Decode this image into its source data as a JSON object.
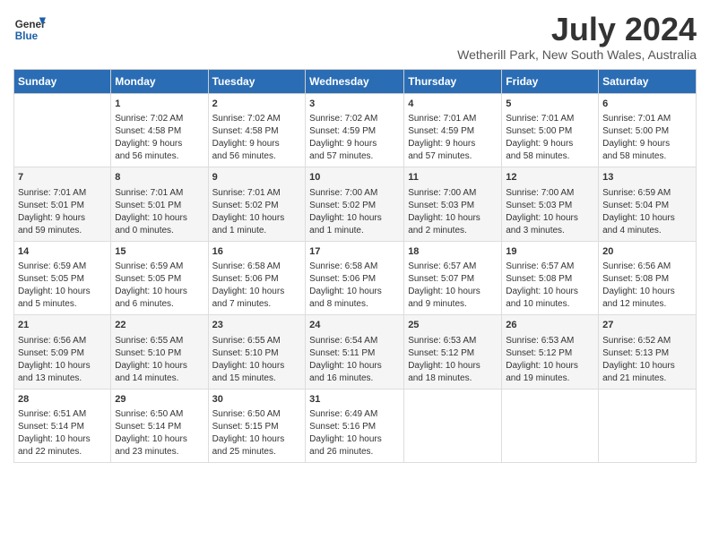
{
  "logo": {
    "line1": "General",
    "line2": "Blue"
  },
  "title": "July 2024",
  "location": "Wetherill Park, New South Wales, Australia",
  "headers": [
    "Sunday",
    "Monday",
    "Tuesday",
    "Wednesday",
    "Thursday",
    "Friday",
    "Saturday"
  ],
  "weeks": [
    [
      {
        "day": "",
        "content": ""
      },
      {
        "day": "1",
        "content": "Sunrise: 7:02 AM\nSunset: 4:58 PM\nDaylight: 9 hours\nand 56 minutes."
      },
      {
        "day": "2",
        "content": "Sunrise: 7:02 AM\nSunset: 4:58 PM\nDaylight: 9 hours\nand 56 minutes."
      },
      {
        "day": "3",
        "content": "Sunrise: 7:02 AM\nSunset: 4:59 PM\nDaylight: 9 hours\nand 57 minutes."
      },
      {
        "day": "4",
        "content": "Sunrise: 7:01 AM\nSunset: 4:59 PM\nDaylight: 9 hours\nand 57 minutes."
      },
      {
        "day": "5",
        "content": "Sunrise: 7:01 AM\nSunset: 5:00 PM\nDaylight: 9 hours\nand 58 minutes."
      },
      {
        "day": "6",
        "content": "Sunrise: 7:01 AM\nSunset: 5:00 PM\nDaylight: 9 hours\nand 58 minutes."
      }
    ],
    [
      {
        "day": "7",
        "content": "Sunrise: 7:01 AM\nSunset: 5:01 PM\nDaylight: 9 hours\nand 59 minutes."
      },
      {
        "day": "8",
        "content": "Sunrise: 7:01 AM\nSunset: 5:01 PM\nDaylight: 10 hours\nand 0 minutes."
      },
      {
        "day": "9",
        "content": "Sunrise: 7:01 AM\nSunset: 5:02 PM\nDaylight: 10 hours\nand 1 minute."
      },
      {
        "day": "10",
        "content": "Sunrise: 7:00 AM\nSunset: 5:02 PM\nDaylight: 10 hours\nand 1 minute."
      },
      {
        "day": "11",
        "content": "Sunrise: 7:00 AM\nSunset: 5:03 PM\nDaylight: 10 hours\nand 2 minutes."
      },
      {
        "day": "12",
        "content": "Sunrise: 7:00 AM\nSunset: 5:03 PM\nDaylight: 10 hours\nand 3 minutes."
      },
      {
        "day": "13",
        "content": "Sunrise: 6:59 AM\nSunset: 5:04 PM\nDaylight: 10 hours\nand 4 minutes."
      }
    ],
    [
      {
        "day": "14",
        "content": "Sunrise: 6:59 AM\nSunset: 5:05 PM\nDaylight: 10 hours\nand 5 minutes."
      },
      {
        "day": "15",
        "content": "Sunrise: 6:59 AM\nSunset: 5:05 PM\nDaylight: 10 hours\nand 6 minutes."
      },
      {
        "day": "16",
        "content": "Sunrise: 6:58 AM\nSunset: 5:06 PM\nDaylight: 10 hours\nand 7 minutes."
      },
      {
        "day": "17",
        "content": "Sunrise: 6:58 AM\nSunset: 5:06 PM\nDaylight: 10 hours\nand 8 minutes."
      },
      {
        "day": "18",
        "content": "Sunrise: 6:57 AM\nSunset: 5:07 PM\nDaylight: 10 hours\nand 9 minutes."
      },
      {
        "day": "19",
        "content": "Sunrise: 6:57 AM\nSunset: 5:08 PM\nDaylight: 10 hours\nand 10 minutes."
      },
      {
        "day": "20",
        "content": "Sunrise: 6:56 AM\nSunset: 5:08 PM\nDaylight: 10 hours\nand 12 minutes."
      }
    ],
    [
      {
        "day": "21",
        "content": "Sunrise: 6:56 AM\nSunset: 5:09 PM\nDaylight: 10 hours\nand 13 minutes."
      },
      {
        "day": "22",
        "content": "Sunrise: 6:55 AM\nSunset: 5:10 PM\nDaylight: 10 hours\nand 14 minutes."
      },
      {
        "day": "23",
        "content": "Sunrise: 6:55 AM\nSunset: 5:10 PM\nDaylight: 10 hours\nand 15 minutes."
      },
      {
        "day": "24",
        "content": "Sunrise: 6:54 AM\nSunset: 5:11 PM\nDaylight: 10 hours\nand 16 minutes."
      },
      {
        "day": "25",
        "content": "Sunrise: 6:53 AM\nSunset: 5:12 PM\nDaylight: 10 hours\nand 18 minutes."
      },
      {
        "day": "26",
        "content": "Sunrise: 6:53 AM\nSunset: 5:12 PM\nDaylight: 10 hours\nand 19 minutes."
      },
      {
        "day": "27",
        "content": "Sunrise: 6:52 AM\nSunset: 5:13 PM\nDaylight: 10 hours\nand 21 minutes."
      }
    ],
    [
      {
        "day": "28",
        "content": "Sunrise: 6:51 AM\nSunset: 5:14 PM\nDaylight: 10 hours\nand 22 minutes."
      },
      {
        "day": "29",
        "content": "Sunrise: 6:50 AM\nSunset: 5:14 PM\nDaylight: 10 hours\nand 23 minutes."
      },
      {
        "day": "30",
        "content": "Sunrise: 6:50 AM\nSunset: 5:15 PM\nDaylight: 10 hours\nand 25 minutes."
      },
      {
        "day": "31",
        "content": "Sunrise: 6:49 AM\nSunset: 5:16 PM\nDaylight: 10 hours\nand 26 minutes."
      },
      {
        "day": "",
        "content": ""
      },
      {
        "day": "",
        "content": ""
      },
      {
        "day": "",
        "content": ""
      }
    ]
  ]
}
